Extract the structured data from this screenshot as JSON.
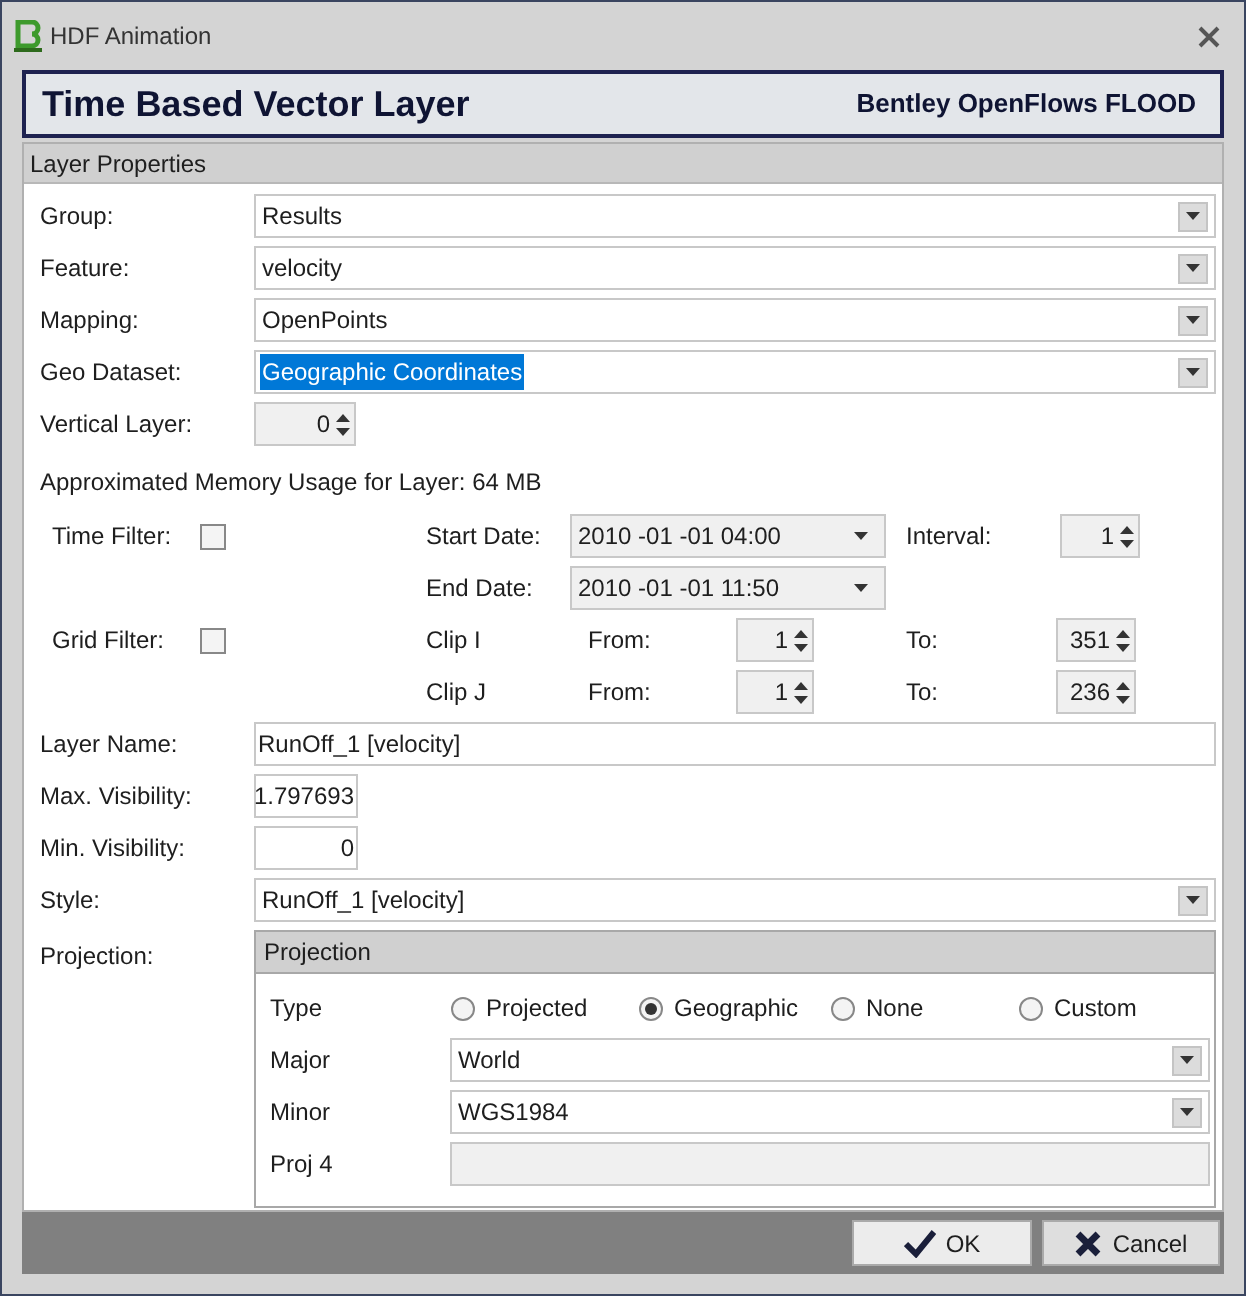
{
  "window": {
    "title": "HDF Animation"
  },
  "header": {
    "title": "Time Based Vector Layer",
    "product": "Bentley OpenFlows FLOOD"
  },
  "panel": {
    "title": "Layer Properties"
  },
  "dropdown_rows": [
    {
      "label": "Group:",
      "value": "Results",
      "highlighted": false
    },
    {
      "label": "Feature:",
      "value": "velocity",
      "highlighted": false
    },
    {
      "label": "Mapping:",
      "value": "OpenPoints",
      "highlighted": false
    },
    {
      "label": "Geo Dataset:",
      "value": "Geographic Coordinates",
      "highlighted": true
    }
  ],
  "vertical_layer": {
    "label": "Vertical Layer:",
    "value": "0"
  },
  "memory_note": "Approximated Memory Usage for Layer: 64 MB",
  "time_filter": {
    "label": "Time Filter:",
    "checked": false,
    "start_label": "Start Date:",
    "start_value": "2010 -01 -01 04:00",
    "end_label": "End Date:",
    "end_value": "2010 -01 -01 11:50",
    "interval_label": "Interval:",
    "interval_value": "1"
  },
  "grid_filter": {
    "label": "Grid Filter:",
    "checked": false,
    "clips": [
      {
        "label": "Clip I",
        "from_label": "From:",
        "from_value": "1",
        "to_label": "To:",
        "to_value": "351"
      },
      {
        "label": "Clip J",
        "from_label": "From:",
        "from_value": "1",
        "to_label": "To:",
        "to_value": "236"
      }
    ]
  },
  "layer_name": {
    "label": "Layer Name:",
    "value": "RunOff_1 [velocity]"
  },
  "max_visibility": {
    "label": "Max. Visibility:",
    "value": "1.797693"
  },
  "min_visibility": {
    "label": "Min. Visibility:",
    "value": "0"
  },
  "style": {
    "label": "Style:",
    "value": "RunOff_1 [velocity]"
  },
  "projection": {
    "label": "Projection:",
    "group_title": "Projection",
    "type_label": "Type",
    "options": [
      {
        "label": "Projected",
        "selected": false
      },
      {
        "label": "Geographic",
        "selected": true
      },
      {
        "label": "None",
        "selected": false
      },
      {
        "label": "Custom",
        "selected": false
      }
    ],
    "major": {
      "label": "Major",
      "value": "World"
    },
    "minor": {
      "label": "Minor",
      "value": "WGS1984"
    },
    "proj4": {
      "label": "Proj 4",
      "disabled": true
    }
  },
  "buttons": [
    {
      "kind": "ok",
      "label": "OK"
    },
    {
      "kind": "cancel",
      "label": "Cancel"
    }
  ]
}
